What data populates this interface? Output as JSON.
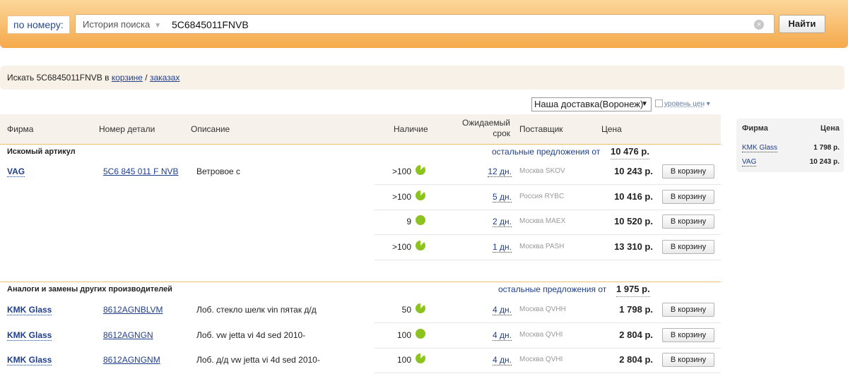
{
  "search": {
    "by_number_label": "по номеру:",
    "history_label": "История поиска",
    "query": "5C6845011FNVB",
    "find_label": "Найти"
  },
  "search_in": {
    "prefix": "Искать 5C6845011FNVB в ",
    "cart_link": "корзине",
    "separator": " / ",
    "orders_link": "заказах"
  },
  "filters": {
    "delivery": "Наша доставка(Воронеж)",
    "price_level": "уровень цен"
  },
  "columns": {
    "firm": "Фирма",
    "part": "Номер детали",
    "desc": "Описание",
    "stock": "Наличие",
    "expected_1": "Ожидаемый",
    "expected_2": "срок",
    "supplier": "Поставщик",
    "price": "Цена"
  },
  "section_main": {
    "title": "Искомый артикул",
    "other": "остальные предложения от",
    "best": "10 476 р."
  },
  "section_analogs": {
    "title": "Аналоги и замены других производителей",
    "other": "остальные предложения от",
    "best": "1 975 р."
  },
  "cart_label": "В корзину",
  "main_rows": [
    {
      "firm": "VAG",
      "part": "5C6 845 011 F NVB",
      "desc": "Ветровое с",
      "stock": ">100",
      "days": "12 дн.",
      "supplier": "Москва SKOV",
      "price": "10 243 р."
    },
    {
      "firm": "",
      "part": "",
      "desc": "",
      "stock": ">100",
      "days": "5 дн.",
      "supplier": "Россия RYBC",
      "price": "10 416 р."
    },
    {
      "firm": "",
      "part": "",
      "desc": "",
      "stock": "9",
      "days": "2 дн.",
      "supplier": "Москва MAEX",
      "price": "10 520 р."
    },
    {
      "firm": "",
      "part": "",
      "desc": "",
      "stock": ">100",
      "days": "1 дн.",
      "supplier": "Москва PASH",
      "price": "13 310 р."
    }
  ],
  "analog_rows": [
    {
      "firm": "KMK Glass",
      "part": "8612AGNBLVM",
      "desc": "Лоб. стекло шелк vin пятак д/д",
      "stock": "50",
      "days": "4 дн.",
      "supplier": "Москва QVHH",
      "price": "1 798 р."
    },
    {
      "firm": "KMK Glass",
      "part": "8612AGNGN",
      "desc": "Лоб. vw jetta vi 4d sed 2010-",
      "stock": "100",
      "days": "4 дн.",
      "supplier": "Москва QVHI",
      "price": "2 804 р."
    },
    {
      "firm": "KMK Glass",
      "part": "8612AGNGNM",
      "desc": "Лоб. д/д vw jetta vi 4d sed 2010-",
      "stock": "100",
      "days": "4 дн.",
      "supplier": "Москва QVHI",
      "price": "2 804 р."
    }
  ],
  "side_panel": {
    "firm_header": "Фирма",
    "price_header": "Цена",
    "items": [
      {
        "firm": "KMK Glass",
        "price": "1 798 р."
      },
      {
        "firm": "VAG",
        "price": "10 243 р."
      }
    ]
  }
}
